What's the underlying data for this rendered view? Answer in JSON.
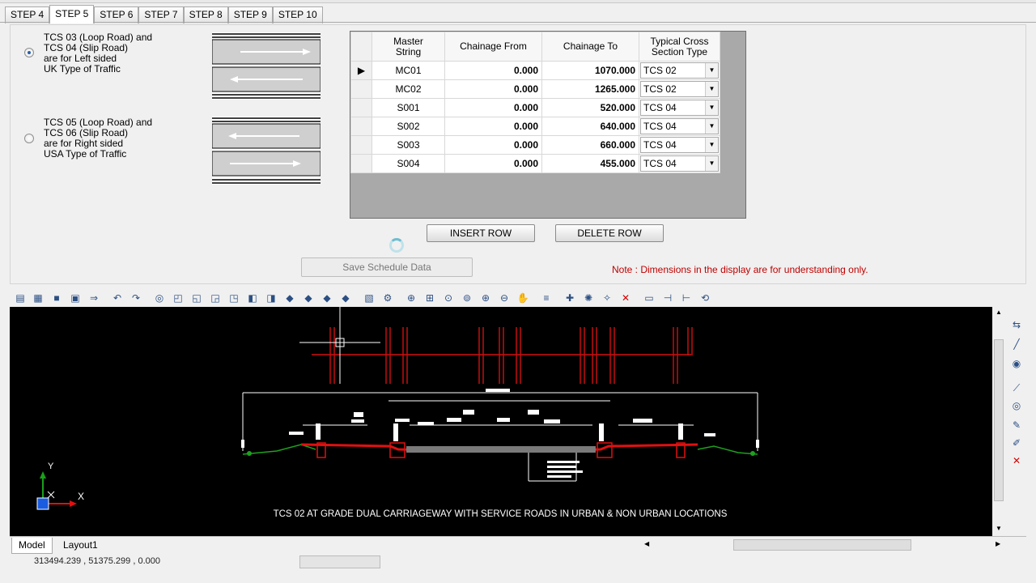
{
  "tabs": [
    "STEP 4",
    "STEP 5",
    "STEP 6",
    "STEP 7",
    "STEP 8",
    "STEP 9",
    "STEP 10"
  ],
  "active_tab": "STEP 5",
  "options": [
    {
      "text": "TCS 03 (Loop Road) and\nTCS 04 (Slip Road)\nare for Left sided\nUK Type of Traffic",
      "selected": true
    },
    {
      "text": "TCS 05 (Loop Road) and\nTCS 06 (Slip Road)\nare for Right sided\nUSA Type of Traffic",
      "selected": false
    }
  ],
  "table": {
    "headers": [
      "Master\nString",
      "Chainage From",
      "Chainage To",
      "Typical Cross\nSection Type"
    ],
    "rows": [
      {
        "master": "MC01",
        "from": "0.000",
        "to": "1070.000",
        "type": "TCS 02",
        "current": true
      },
      {
        "master": "MC02",
        "from": "0.000",
        "to": "1265.000",
        "type": "TCS 02",
        "current": false
      },
      {
        "master": "S001",
        "from": "0.000",
        "to": "520.000",
        "type": "TCS 04",
        "current": false
      },
      {
        "master": "S002",
        "from": "0.000",
        "to": "640.000",
        "type": "TCS 04",
        "current": false
      },
      {
        "master": "S003",
        "from": "0.000",
        "to": "660.000",
        "type": "TCS 04",
        "current": false
      },
      {
        "master": "S004",
        "from": "0.000",
        "to": "455.000",
        "type": "TCS 04",
        "current": false
      }
    ]
  },
  "buttons": {
    "insert": "INSERT ROW",
    "delete": "DELETE ROW",
    "save": "Save Schedule Data"
  },
  "note": "Note : Dimensions in the display are for understanding only.",
  "cad": {
    "caption": "TCS 02 AT GRADE DUAL CARRIAGEWAY WITH SERVICE ROADS IN URBAN & NON URBAN LOCATIONS",
    "axis_y": "Y",
    "axis_x": "X"
  },
  "layout_tabs": [
    "Model",
    "Layout1"
  ],
  "status": {
    "coords": "313494.239 , 51375.299 , 0.000"
  }
}
